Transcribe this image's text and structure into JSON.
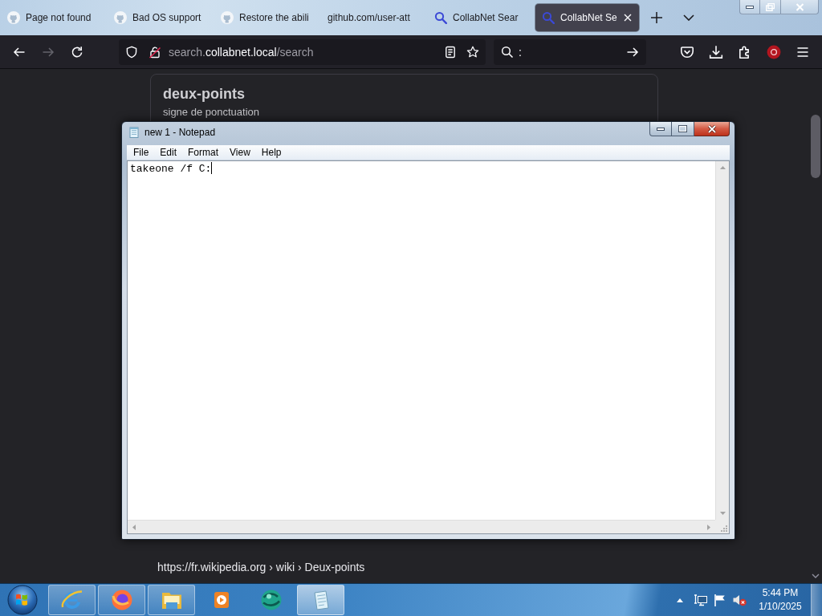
{
  "browser": {
    "tabs": [
      {
        "label": "Page not found",
        "kind": "github",
        "selected": false
      },
      {
        "label": "Bad OS support",
        "kind": "github",
        "selected": false
      },
      {
        "label": "Restore the abili",
        "kind": "github",
        "selected": false
      },
      {
        "label": "github.com/user-att",
        "kind": "none",
        "selected": false
      },
      {
        "label": "CollabNet Sear",
        "kind": "search",
        "selected": false
      },
      {
        "label": "CollabNet Se",
        "kind": "search",
        "selected": true
      }
    ],
    "navigation": {
      "back": {
        "disabled": false
      },
      "forward": {
        "disabled": true
      }
    },
    "address_bar": {
      "url_prefix": "search.",
      "url_domain": "collabnet.local",
      "url_path": "/search"
    },
    "search_bar": {
      "value": ":"
    }
  },
  "page": {
    "result": {
      "title": "deux-points",
      "description": "signe de ponctuation"
    },
    "next_result_url": "https://fr.wikipedia.org › wiki › Deux-points"
  },
  "notepad": {
    "title": "new 1 - Notepad",
    "menu": [
      "File",
      "Edit",
      "Format",
      "View",
      "Help"
    ],
    "text": "takeone /f C:"
  },
  "taskbar": {
    "apps": [
      {
        "kind": "e-browser",
        "running": true,
        "selected": false
      },
      {
        "kind": "fox-browser",
        "running": true,
        "selected": false
      },
      {
        "kind": "folder",
        "running": true,
        "selected": false
      },
      {
        "kind": "media",
        "running": false,
        "selected": false
      },
      {
        "kind": "globe",
        "running": false,
        "selected": false
      },
      {
        "kind": "notepad",
        "running": true,
        "selected": true
      }
    ],
    "tray": {
      "volume_muted": true
    },
    "clock": {
      "time": "5:44 PM",
      "date": "1/10/2025"
    }
  }
}
